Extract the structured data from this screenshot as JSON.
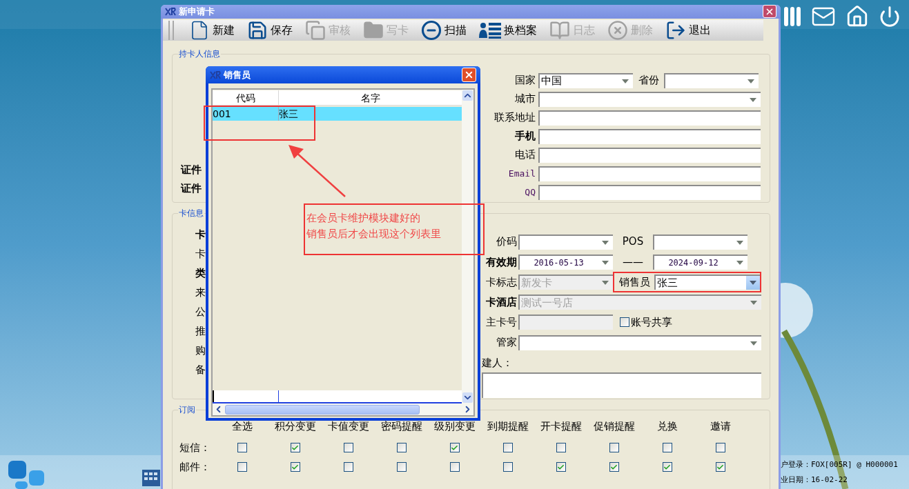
{
  "window": {
    "title": "新申请卡",
    "toolbar": [
      {
        "kind": "file",
        "label": "新建",
        "disabled": false
      },
      {
        "kind": "save",
        "label": "保存",
        "disabled": false
      },
      {
        "kind": "copy",
        "label": "审核",
        "disabled": true
      },
      {
        "kind": "folder",
        "label": "写卡",
        "disabled": true
      },
      {
        "kind": "scan",
        "label": "扫描",
        "disabled": false
      },
      {
        "kind": "profile",
        "label": "换档案",
        "disabled": false
      },
      {
        "kind": "book",
        "label": "日志",
        "disabled": true
      },
      {
        "kind": "delete",
        "label": "删除",
        "disabled": true
      },
      {
        "kind": "exit",
        "label": "退出",
        "disabled": false
      }
    ]
  },
  "holder_info": {
    "legend": "持卡人信息",
    "left_labels": [
      {
        "text": "证件",
        "bold": true
      },
      {
        "text": "证件",
        "bold": true
      }
    ],
    "rows": [
      [
        {
          "label": "国家",
          "value": "中国",
          "dropdown": true
        },
        {
          "label": "省份",
          "dropdown": true
        }
      ],
      [
        {
          "label": "城市",
          "dropdown": true
        }
      ],
      [
        {
          "label": "联系地址",
          "dropdown": false
        }
      ],
      [
        {
          "label": "手机",
          "dropdown": false,
          "bold": true
        }
      ],
      [
        {
          "label": "电话",
          "dropdown": false
        }
      ],
      [
        {
          "label": "Email",
          "dropdown": false,
          "latin": true
        }
      ],
      [
        {
          "label": "QQ",
          "dropdown": false,
          "latin": true
        }
      ]
    ]
  },
  "card_info": {
    "legend": "卡信息",
    "left_labels": [
      {
        "text": "卡",
        "bold": true
      },
      {
        "text": "卡",
        "bold": false
      },
      {
        "text": "类",
        "bold": true
      },
      {
        "text": "来",
        "bold": false
      },
      {
        "text": "公",
        "bold": false
      },
      {
        "text": "推",
        "bold": false
      },
      {
        "text": "购",
        "bold": false
      },
      {
        "text": "备",
        "bold": false
      }
    ],
    "rows": [
      [
        {
          "kind": "select",
          "label": "价码",
          "dropdown": true
        },
        {
          "kind": "select",
          "label": "POS",
          "dropdown": true
        }
      ],
      [
        {
          "kind": "select",
          "label": "有效期",
          "bold": true,
          "value": "2016-05-13",
          "dropdown": true
        },
        {
          "kind": "select",
          "separator": "——",
          "value": "2024-09-12",
          "dropdown": true
        }
      ],
      [
        {
          "kind": "select",
          "label": "卡标志",
          "value": "新发卡",
          "dropdown": true,
          "disabled": true
        },
        {
          "kind": "select",
          "label": "销售员",
          "value": "张三",
          "dropdown": true,
          "focused": true
        }
      ],
      [
        {
          "kind": "select",
          "label": "卡酒店",
          "bold": true,
          "value": "测试一号店",
          "dropdown": true,
          "disabled": true
        }
      ],
      [
        {
          "kind": "select",
          "label": "主卡号",
          "dropdown": false,
          "disabled": true
        },
        {
          "kind": "checkbox",
          "label": "账号共享",
          "checked": false
        }
      ],
      [
        {
          "kind": "select",
          "label": "管家",
          "dropdown": true
        }
      ],
      [
        {
          "kind": "note",
          "label": "建人："
        }
      ]
    ]
  },
  "subscription": {
    "legend": "订阅",
    "columns": [
      "全选",
      "积分变更",
      "卡值变更",
      "密码提醒",
      "级别变更",
      "到期提醒",
      "开卡提醒",
      "促销提醒",
      "兑换",
      "邀请"
    ],
    "rows": [
      {
        "label": "短信：",
        "checks": [
          false,
          true,
          false,
          false,
          true,
          false,
          false,
          false,
          false,
          false
        ]
      },
      {
        "label": "邮件：",
        "checks": [
          false,
          true,
          false,
          false,
          false,
          false,
          true,
          true,
          true,
          true
        ]
      }
    ]
  },
  "salesperson_dialog": {
    "title": "销售员",
    "columns": [
      "代码",
      "名字"
    ],
    "rows": [
      {
        "cells": [
          "001",
          "张三"
        ],
        "selected": true
      }
    ]
  },
  "annotation": {
    "lines": [
      "在会员卡维护模块建好的",
      "销售员后才会出现这个列表里"
    ]
  },
  "status_bar": [
    "户登录：FOX[005R] @ H000001",
    "业日期：16-02-22"
  ]
}
